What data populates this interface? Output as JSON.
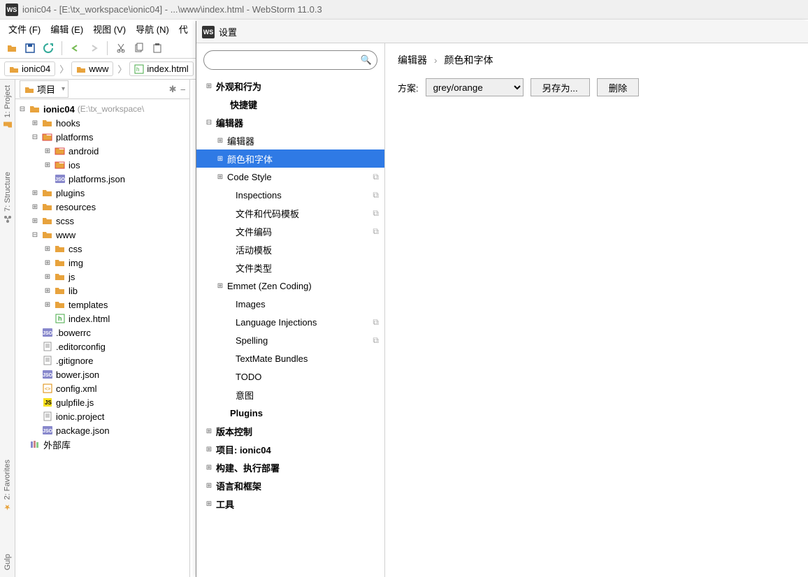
{
  "window": {
    "title": "ionic04 - [E:\\tx_workspace\\ionic04] - ...\\www\\index.html - WebStorm 11.0.3",
    "app_icon_text": "WS"
  },
  "menu": [
    "文件 (F)",
    "编辑 (E)",
    "视图 (V)",
    "导航 (N)",
    "代"
  ],
  "breadcrumb": [
    {
      "label": "ionic04",
      "icon": "folder"
    },
    {
      "label": "www",
      "icon": "folder"
    },
    {
      "label": "index.html",
      "icon": "html"
    }
  ],
  "rails": {
    "project": "1: Project",
    "structure": "7: Structure",
    "favorites": "2: Favorites",
    "gulp": "Gulp"
  },
  "project_panel": {
    "dropdown_label": "项目",
    "tree": [
      {
        "lvl": 0,
        "toggle": "⊟",
        "icon": "folder",
        "label": "ionic04",
        "bold": true,
        "path": "(E:\\tx_workspace\\"
      },
      {
        "lvl": 1,
        "toggle": "⊞",
        "icon": "folder",
        "label": "hooks"
      },
      {
        "lvl": 1,
        "toggle": "⊟",
        "icon": "folder-red",
        "label": "platforms"
      },
      {
        "lvl": 2,
        "toggle": "⊞",
        "icon": "folder-red",
        "label": "android"
      },
      {
        "lvl": 2,
        "toggle": "⊞",
        "icon": "folder-red",
        "label": "ios"
      },
      {
        "lvl": 2,
        "toggle": "",
        "icon": "json",
        "label": "platforms.json"
      },
      {
        "lvl": 1,
        "toggle": "⊞",
        "icon": "folder",
        "label": "plugins"
      },
      {
        "lvl": 1,
        "toggle": "⊞",
        "icon": "folder",
        "label": "resources"
      },
      {
        "lvl": 1,
        "toggle": "⊞",
        "icon": "folder",
        "label": "scss"
      },
      {
        "lvl": 1,
        "toggle": "⊟",
        "icon": "folder",
        "label": "www"
      },
      {
        "lvl": 2,
        "toggle": "⊞",
        "icon": "folder",
        "label": "css"
      },
      {
        "lvl": 2,
        "toggle": "⊞",
        "icon": "folder",
        "label": "img"
      },
      {
        "lvl": 2,
        "toggle": "⊞",
        "icon": "folder",
        "label": "js"
      },
      {
        "lvl": 2,
        "toggle": "⊞",
        "icon": "folder",
        "label": "lib"
      },
      {
        "lvl": 2,
        "toggle": "⊞",
        "icon": "folder",
        "label": "templates"
      },
      {
        "lvl": 2,
        "toggle": "",
        "icon": "html",
        "label": "index.html"
      },
      {
        "lvl": 1,
        "toggle": "",
        "icon": "json",
        "label": ".bowerrc"
      },
      {
        "lvl": 1,
        "toggle": "",
        "icon": "file",
        "label": ".editorconfig"
      },
      {
        "lvl": 1,
        "toggle": "",
        "icon": "file",
        "label": ".gitignore"
      },
      {
        "lvl": 1,
        "toggle": "",
        "icon": "json",
        "label": "bower.json"
      },
      {
        "lvl": 1,
        "toggle": "",
        "icon": "xml",
        "label": "config.xml"
      },
      {
        "lvl": 1,
        "toggle": "",
        "icon": "js",
        "label": "gulpfile.js"
      },
      {
        "lvl": 1,
        "toggle": "",
        "icon": "file",
        "label": "ionic.project"
      },
      {
        "lvl": 1,
        "toggle": "",
        "icon": "json",
        "label": "package.json"
      },
      {
        "lvl": 0,
        "toggle": "",
        "icon": "lib",
        "label": "外部库"
      }
    ]
  },
  "dialog": {
    "title": "设置",
    "icon_text": "WS",
    "search_placeholder": "",
    "tree": [
      {
        "lvl": 1,
        "toggle": "⊞",
        "label": "外观和行为",
        "bold": true
      },
      {
        "lvl": 2,
        "toggle": "",
        "label": "快捷键",
        "bold": true,
        "notoggle": true
      },
      {
        "lvl": 1,
        "toggle": "⊟",
        "label": "编辑器",
        "bold": true
      },
      {
        "lvl": 2,
        "toggle": "⊞",
        "label": "编辑器"
      },
      {
        "lvl": 2,
        "toggle": "⊞",
        "label": "颜色和字体",
        "selected": true
      },
      {
        "lvl": 2,
        "toggle": "⊞",
        "label": "Code Style",
        "copy": true
      },
      {
        "lvl": 3,
        "toggle": "",
        "label": "Inspections",
        "copy": true
      },
      {
        "lvl": 3,
        "toggle": "",
        "label": "文件和代码模板",
        "copy": true
      },
      {
        "lvl": 3,
        "toggle": "",
        "label": "文件编码",
        "copy": true
      },
      {
        "lvl": 3,
        "toggle": "",
        "label": "活动模板"
      },
      {
        "lvl": 3,
        "toggle": "",
        "label": "文件类型"
      },
      {
        "lvl": 2,
        "toggle": "⊞",
        "label": "Emmet (Zen Coding)"
      },
      {
        "lvl": 3,
        "toggle": "",
        "label": "Images"
      },
      {
        "lvl": 3,
        "toggle": "",
        "label": "Language Injections",
        "copy": true
      },
      {
        "lvl": 3,
        "toggle": "",
        "label": "Spelling",
        "copy": true
      },
      {
        "lvl": 3,
        "toggle": "",
        "label": "TextMate Bundles"
      },
      {
        "lvl": 3,
        "toggle": "",
        "label": "TODO"
      },
      {
        "lvl": 3,
        "toggle": "",
        "label": "意图"
      },
      {
        "lvl": 2,
        "toggle": "",
        "label": "Plugins",
        "bold": true,
        "notoggle": true
      },
      {
        "lvl": 1,
        "toggle": "⊞",
        "label": "版本控制",
        "bold": true
      },
      {
        "lvl": 1,
        "toggle": "⊞",
        "label": "项目: ionic04",
        "bold": true
      },
      {
        "lvl": 1,
        "toggle": "⊞",
        "label": "构建、执行部署",
        "bold": true
      },
      {
        "lvl": 1,
        "toggle": "⊞",
        "label": "语言和框架",
        "bold": true
      },
      {
        "lvl": 1,
        "toggle": "⊞",
        "label": "工具",
        "bold": true
      }
    ],
    "right": {
      "breadcrumb": [
        "编辑器",
        "颜色和字体"
      ],
      "scheme_label": "方案:",
      "scheme_value": "grey/orange",
      "save_as": "另存为...",
      "delete": "删除"
    }
  }
}
